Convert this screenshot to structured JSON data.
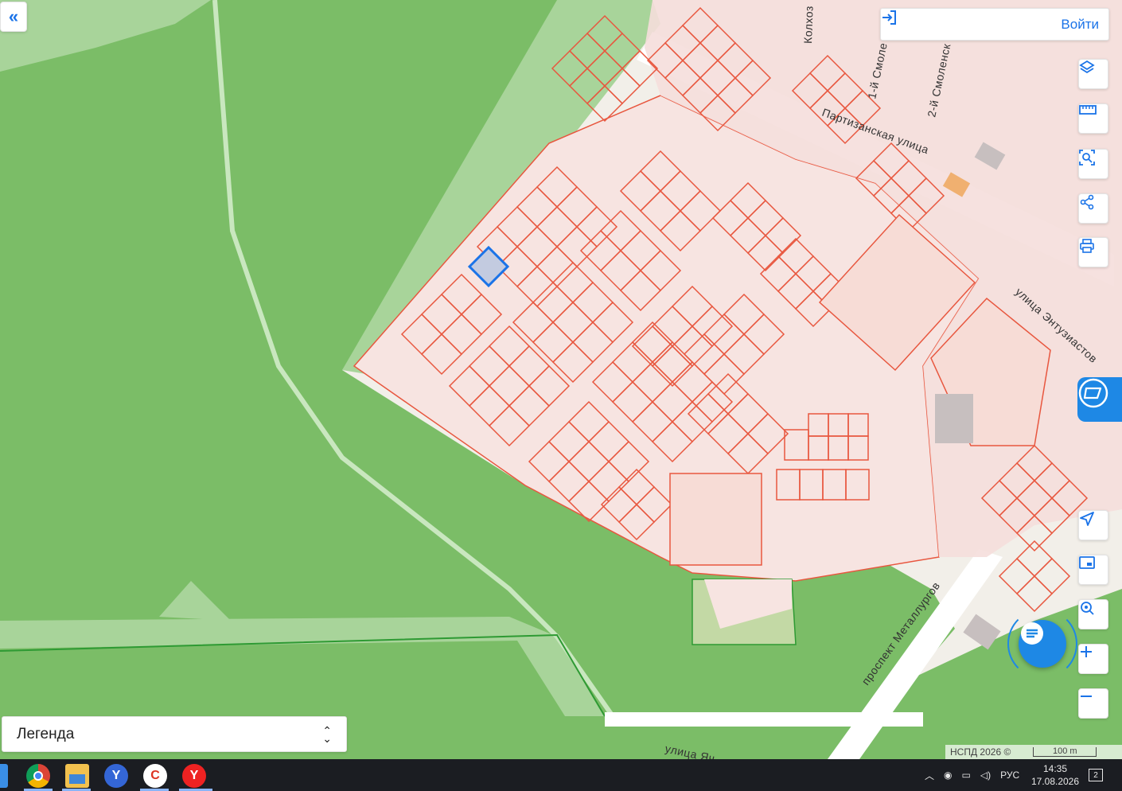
{
  "header": {
    "login_label": "Войти",
    "collapse_icon": "double-chevron-left-icon"
  },
  "streets": {
    "partizanskaya": "Партизанская улица",
    "entuziastov": "улица Энтузиастов",
    "metallurgov": "проспект Металлургов",
    "smolenskiy1": "1-й Смоле",
    "smolenskiy2": "2-й Смоленск",
    "kolkhoz": "Колхоз",
    "bottom": "улица Яч"
  },
  "tools": [
    {
      "name": "layers-icon"
    },
    {
      "name": "ruler-icon"
    },
    {
      "name": "select-area-icon"
    },
    {
      "name": "share-icon"
    },
    {
      "name": "print-icon"
    },
    {
      "name": "locate-icon"
    },
    {
      "name": "minimap-icon"
    },
    {
      "name": "search-location-icon"
    },
    {
      "name": "zoom-in-icon"
    },
    {
      "name": "zoom-out-icon"
    }
  ],
  "legend": {
    "label": "Легенда"
  },
  "attribution": {
    "text": "НСПД 2026 ©",
    "scale": "100 m"
  },
  "taskbar": {
    "lang": "РУС",
    "time": "14:35",
    "date": "17.08.2026",
    "notifications": "2"
  },
  "colors": {
    "forest": "#7bbd67",
    "forest_light": "#a8d49a",
    "parcel_fill": "#f7e4e1",
    "parcel_stroke": "#e8573f",
    "selected": "#1a73e8",
    "accent": "#1e88e5"
  }
}
